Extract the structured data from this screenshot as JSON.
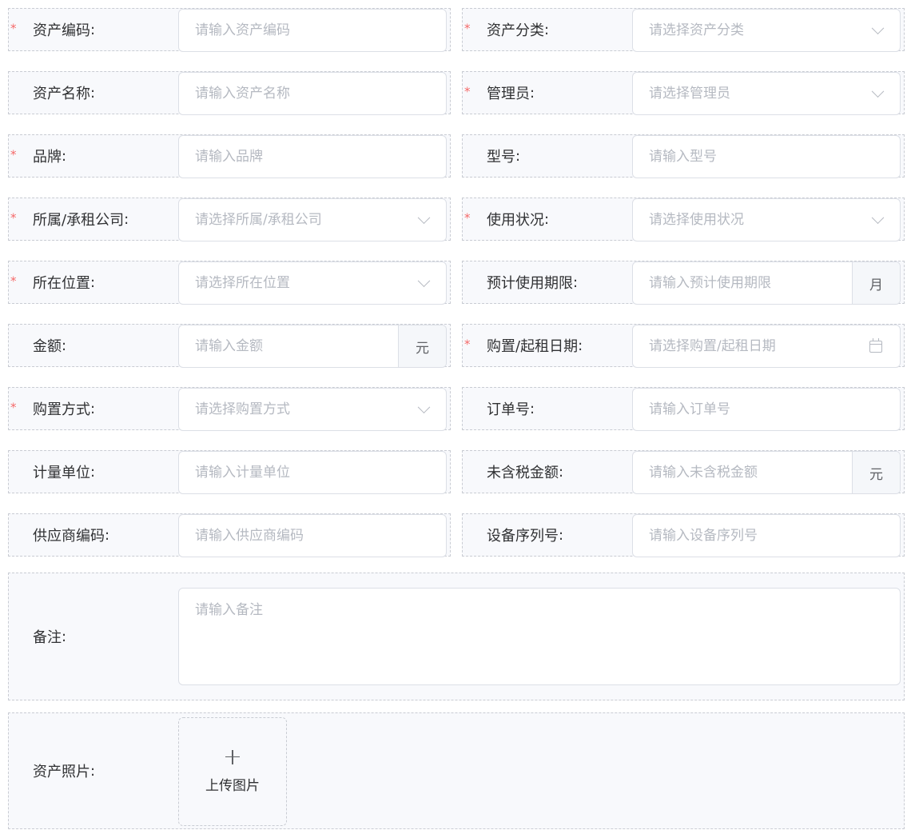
{
  "form": {
    "rows": [
      {
        "left": {
          "label": "资产编码",
          "required": true,
          "type": "input",
          "placeholder": "请输入资产编码"
        },
        "right": {
          "label": "资产分类",
          "required": true,
          "type": "select",
          "placeholder": "请选择资产分类"
        }
      },
      {
        "left": {
          "label": "资产名称",
          "required": false,
          "type": "input",
          "placeholder": "请输入资产名称"
        },
        "right": {
          "label": "管理员",
          "required": true,
          "type": "select",
          "placeholder": "请选择管理员"
        }
      },
      {
        "left": {
          "label": "品牌",
          "required": true,
          "type": "input",
          "placeholder": "请输入品牌"
        },
        "right": {
          "label": "型号",
          "required": false,
          "type": "input",
          "placeholder": "请输入型号"
        }
      },
      {
        "left": {
          "label": "所属/承租公司",
          "required": true,
          "type": "select",
          "placeholder": "请选择所属/承租公司"
        },
        "right": {
          "label": "使用状况",
          "required": true,
          "type": "select",
          "placeholder": "请选择使用状况"
        }
      },
      {
        "left": {
          "label": "所在位置",
          "required": true,
          "type": "select",
          "placeholder": "请选择所在位置"
        },
        "right": {
          "label": "预计使用期限",
          "required": false,
          "type": "append",
          "placeholder": "请输入预计使用期限",
          "append": "月"
        }
      },
      {
        "left": {
          "label": "金额",
          "required": false,
          "type": "append",
          "placeholder": "请输入金额",
          "append": "元"
        },
        "right": {
          "label": "购置/起租日期",
          "required": true,
          "type": "date",
          "placeholder": "请选择购置/起租日期"
        }
      },
      {
        "left": {
          "label": "购置方式",
          "required": true,
          "type": "select",
          "placeholder": "请选择购置方式"
        },
        "right": {
          "label": "订单号",
          "required": false,
          "type": "input",
          "placeholder": "请输入订单号"
        }
      },
      {
        "left": {
          "label": "计量单位",
          "required": false,
          "type": "input",
          "placeholder": "请输入计量单位"
        },
        "right": {
          "label": "未含税金额",
          "required": false,
          "type": "append",
          "placeholder": "请输入未含税金额",
          "append": "元"
        }
      },
      {
        "left": {
          "label": "供应商编码",
          "required": false,
          "type": "input",
          "placeholder": "请输入供应商编码"
        },
        "right": {
          "label": "设备序列号",
          "required": false,
          "type": "input",
          "placeholder": "请输入设备序列号"
        }
      }
    ],
    "remark": {
      "label": "备注",
      "placeholder": "请输入备注"
    },
    "photo": {
      "label": "资产照片",
      "upload_text": "上传图片"
    },
    "colon": ":",
    "required_mark": "*"
  },
  "icons": {
    "select": "chevron-down-icon",
    "date": "calendar-icon",
    "upload": "plus-icon"
  },
  "colors": {
    "required": "#f56c6c",
    "border": "#dcdfe6",
    "placeholder": "#b5b9c1",
    "cell_bg": "#f8f9fc"
  }
}
